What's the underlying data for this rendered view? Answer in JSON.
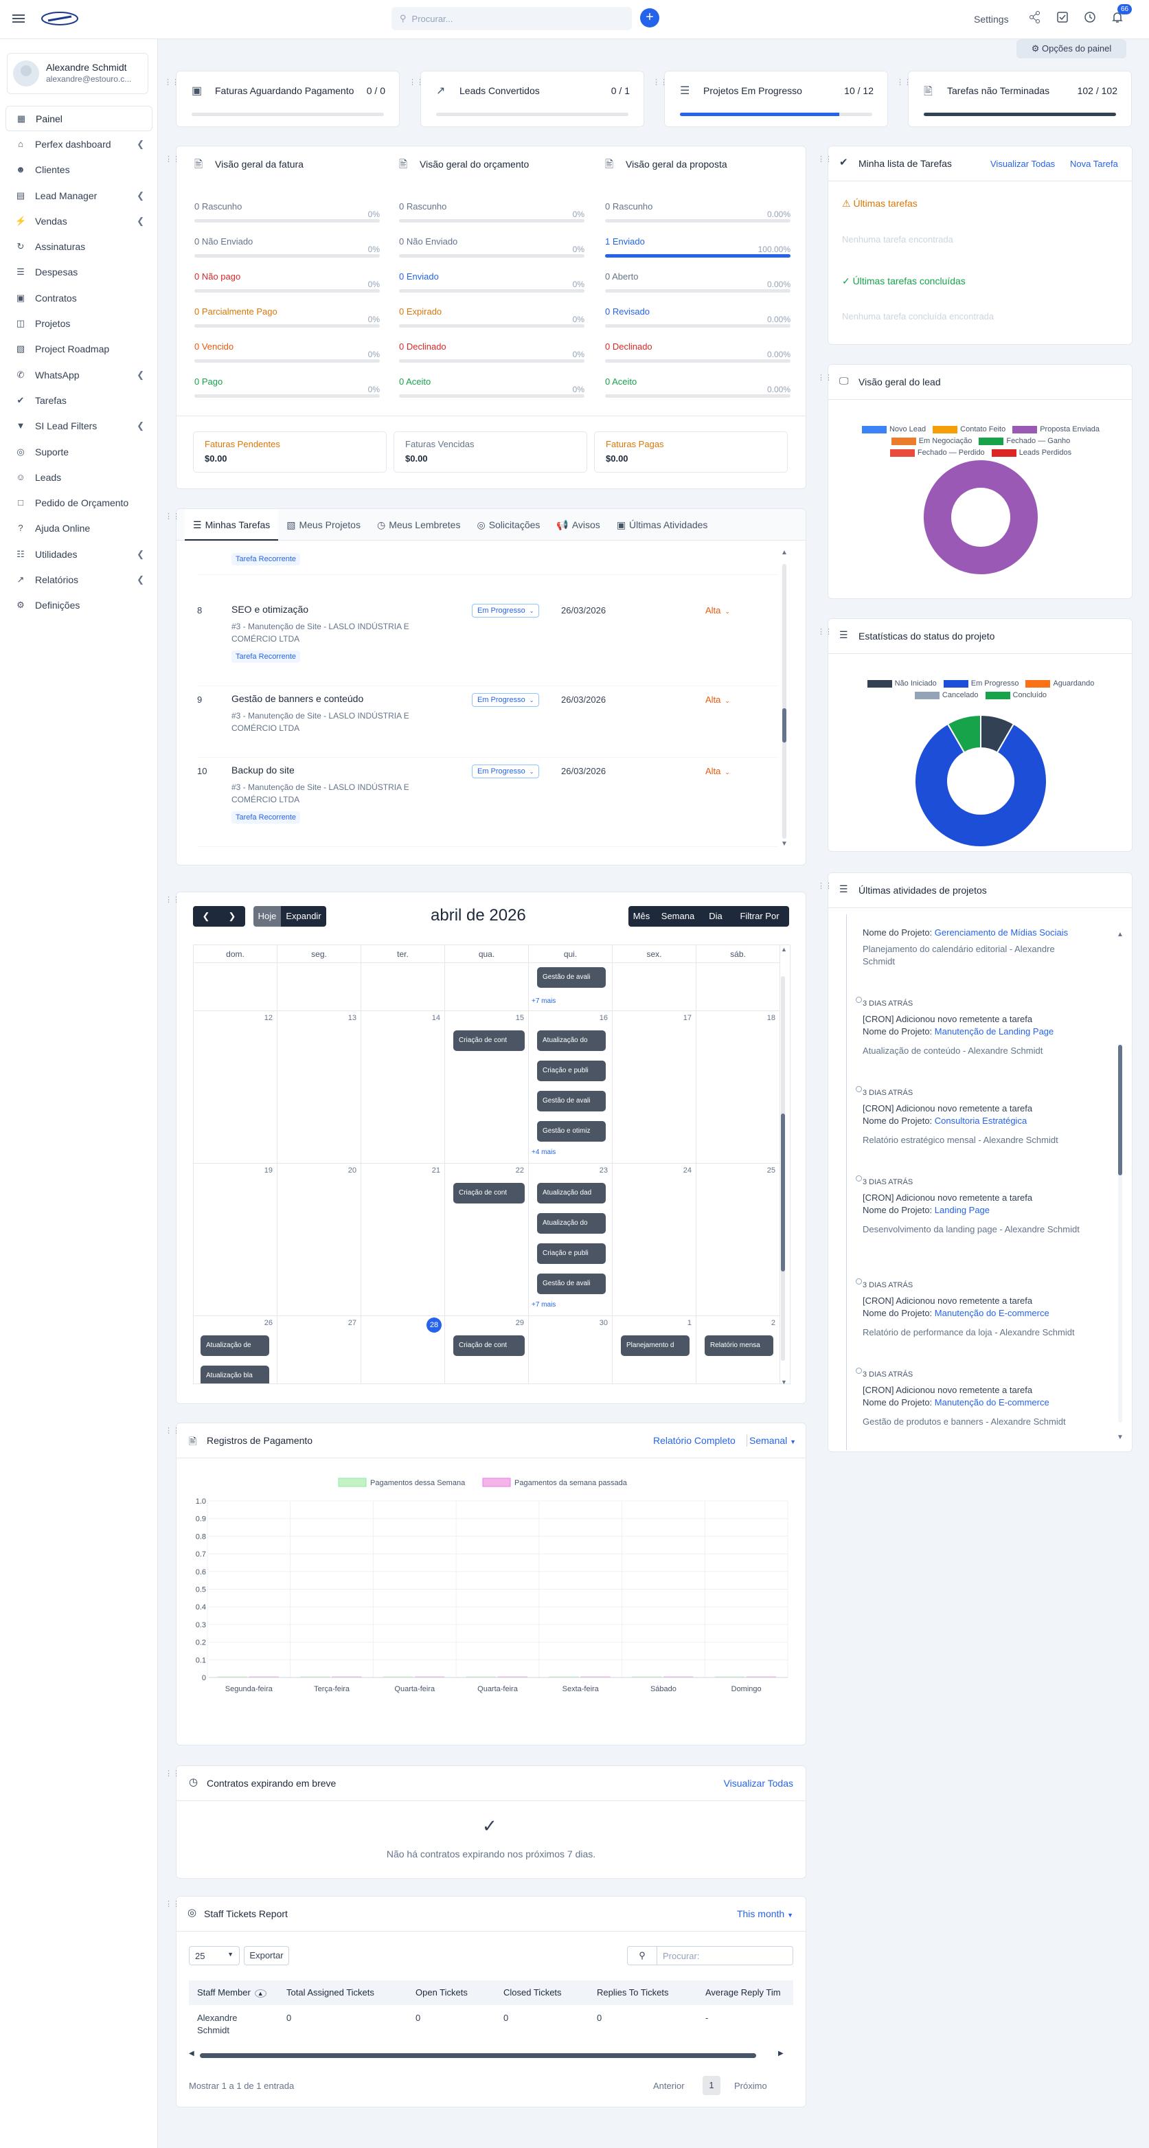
{
  "topbar": {
    "search_placeholder": "Procurar...",
    "settings": "Settings",
    "notif_count": "66"
  },
  "user": {
    "name": "Alexandre Schmidt",
    "email": "alexandre@estouro.c..."
  },
  "nav": [
    {
      "label": "Painel",
      "icon": "dashboard-icon",
      "active": true
    },
    {
      "label": "Perfex dashboard",
      "icon": "home-icon",
      "chevron": true
    },
    {
      "label": "Clientes",
      "icon": "user-icon"
    },
    {
      "label": "Lead Manager",
      "icon": "briefcase-icon",
      "chevron": true
    },
    {
      "label": "Vendas",
      "icon": "bolt-icon",
      "chevron": true
    },
    {
      "label": "Assinaturas",
      "icon": "refresh-icon"
    },
    {
      "label": "Despesas",
      "icon": "receipt-icon"
    },
    {
      "label": "Contratos",
      "icon": "document-icon"
    },
    {
      "label": "Projetos",
      "icon": "folder-icon"
    },
    {
      "label": "Project Roadmap",
      "icon": "chart-icon"
    },
    {
      "label": "WhatsApp",
      "icon": "whatsapp-icon",
      "chevron": true
    },
    {
      "label": "Tarefas",
      "icon": "check-circle-icon"
    },
    {
      "label": "SI Lead Filters",
      "icon": "filter-icon",
      "chevron": true
    },
    {
      "label": "Suporte",
      "icon": "lifebuoy-icon"
    },
    {
      "label": "Leads",
      "icon": "users-icon"
    },
    {
      "label": "Pedido de Orçamento",
      "icon": "file-icon"
    },
    {
      "label": "Ajuda Online",
      "icon": "help-icon"
    },
    {
      "label": "Utilidades",
      "icon": "grid-icon",
      "chevron": true
    },
    {
      "label": "Relatórios",
      "icon": "trend-icon",
      "chevron": true
    },
    {
      "label": "Definições",
      "icon": "gear-icon"
    }
  ],
  "panel_options": "Opções do painel",
  "stats": [
    {
      "label": "Faturas Aguardando Pagamento",
      "value": "0 / 0",
      "progress": 0,
      "color": "#2563eb"
    },
    {
      "label": "Leads Convertidos",
      "value": "0 / 1",
      "progress": 0,
      "color": "#2563eb"
    },
    {
      "label": "Projetos Em Progresso",
      "value": "10 / 12",
      "progress": 0.83,
      "color": "#2563eb"
    },
    {
      "label": "Tarefas não Terminadas",
      "value": "102 / 102",
      "progress": 1.0,
      "color": "#334155"
    }
  ],
  "overview": {
    "columns": [
      {
        "title": "Visão geral da fatura",
        "rows": [
          {
            "label": "0 Rascunho",
            "pct": "0%",
            "color": "#64748b",
            "fill": 0
          },
          {
            "label": "0 Não Enviado",
            "pct": "0%",
            "color": "#64748b",
            "fill": 0
          },
          {
            "label": "0 Não pago",
            "pct": "0%",
            "color": "#dc2626",
            "fill": 0
          },
          {
            "label": "0 Parcialmente Pago",
            "pct": "0%",
            "color": "#d97706",
            "fill": 0
          },
          {
            "label": "0 Vencido",
            "pct": "0%",
            "color": "#ea580c",
            "fill": 0
          },
          {
            "label": "0 Pago",
            "pct": "0%",
            "color": "#16a34a",
            "fill": 0
          }
        ]
      },
      {
        "title": "Visão geral do orçamento",
        "rows": [
          {
            "label": "0 Rascunho",
            "pct": "0%",
            "color": "#64748b",
            "fill": 0
          },
          {
            "label": "0 Não Enviado",
            "pct": "0%",
            "color": "#64748b",
            "fill": 0
          },
          {
            "label": "0 Enviado",
            "pct": "0%",
            "color": "#2563eb",
            "fill": 0
          },
          {
            "label": "0 Expirado",
            "pct": "0%",
            "color": "#d97706",
            "fill": 0
          },
          {
            "label": "0 Declinado",
            "pct": "0%",
            "color": "#dc2626",
            "fill": 0
          },
          {
            "label": "0 Aceito",
            "pct": "0%",
            "color": "#16a34a",
            "fill": 0
          }
        ]
      },
      {
        "title": "Visão geral da proposta",
        "rows": [
          {
            "label": "0 Rascunho",
            "pct": "0.00%",
            "color": "#64748b",
            "fill": 0
          },
          {
            "label": "1 Enviado",
            "pct": "100.00%",
            "color": "#2563eb",
            "fill": 1
          },
          {
            "label": "0 Aberto",
            "pct": "0.00%",
            "color": "#64748b",
            "fill": 0
          },
          {
            "label": "0 Revisado",
            "pct": "0.00%",
            "color": "#2563eb",
            "fill": 0
          },
          {
            "label": "0 Declinado",
            "pct": "0.00%",
            "color": "#dc2626",
            "fill": 0
          },
          {
            "label": "0 Aceito",
            "pct": "0.00%",
            "color": "#16a34a",
            "fill": 0
          }
        ]
      }
    ],
    "summary": [
      {
        "label": "Faturas Pendentes",
        "value": "$0.00",
        "color": "#d97706"
      },
      {
        "label": "Faturas Vencidas",
        "value": "$0.00",
        "color": "#64748b"
      },
      {
        "label": "Faturas Pagas",
        "value": "$0.00",
        "color": "#d97706"
      }
    ]
  },
  "tasks_tabs": [
    "Minhas Tarefas",
    "Meus Projetos",
    "Meus Lembretes",
    "Solicitações",
    "Avisos",
    "Últimas Atividades"
  ],
  "tasks": [
    {
      "num": "8",
      "name": "SEO e otimização",
      "project": "#3 - Manutenção de Site - LASLO INDÚSTRIA E COMÉRCIO LTDA",
      "recurring": "Tarefa Recorrente",
      "status": "Em Progresso",
      "date": "26/03/2026",
      "priority": "Alta"
    },
    {
      "num": "9",
      "name": "Gestão de banners e conteúdo",
      "project": "#3 - Manutenção de Site - LASLO INDÚSTRIA E COMÉRCIO LTDA",
      "status": "Em Progresso",
      "date": "26/03/2026",
      "priority": "Alta"
    },
    {
      "num": "10",
      "name": "Backup do site",
      "project": "#3 - Manutenção de Site - LASLO INDÚSTRIA E COMÉRCIO LTDA",
      "recurring": "Tarefa Recorrente",
      "status": "Em Progresso",
      "date": "26/03/2026",
      "priority": "Alta"
    }
  ],
  "task_top_badge": "Tarefa Recorrente",
  "calendar": {
    "title": "abril de 2026",
    "today": "Hoje",
    "expand": "Expandir",
    "views": [
      "Mês",
      "Semana",
      "Dia",
      "Filtrar Por"
    ],
    "weekdays": [
      "dom.",
      "seg.",
      "ter.",
      "qua.",
      "qui.",
      "sex.",
      "sáb."
    ],
    "weeks": [
      {
        "days": [
          "",
          "",
          "",
          "",
          "",
          "",
          ""
        ],
        "events": [
          {
            "col": 4,
            "slot": 0,
            "text": "Gestão de avali"
          }
        ],
        "more": [
          {
            "col": 4,
            "text": "+7 mais"
          }
        ]
      },
      {
        "days": [
          "12",
          "13",
          "14",
          "15",
          "16",
          "17",
          "18"
        ],
        "events": [
          {
            "col": 3,
            "slot": 0,
            "text": "Criação de cont"
          },
          {
            "col": 4,
            "slot": 0,
            "text": "Atualização do"
          },
          {
            "col": 4,
            "slot": 1,
            "text": "Criação e publi"
          },
          {
            "col": 4,
            "slot": 2,
            "text": "Gestão de avali"
          },
          {
            "col": 4,
            "slot": 3,
            "text": "Gestão e otimiz"
          }
        ],
        "more": [
          {
            "col": 4,
            "text": "+4 mais"
          }
        ]
      },
      {
        "days": [
          "19",
          "20",
          "21",
          "22",
          "23",
          "24",
          "25"
        ],
        "events": [
          {
            "col": 3,
            "slot": 0,
            "text": "Criação de cont"
          },
          {
            "col": 4,
            "slot": 0,
            "text": "Atualização dad"
          },
          {
            "col": 4,
            "slot": 1,
            "text": "Atualização do"
          },
          {
            "col": 4,
            "slot": 2,
            "text": "Criação e publi"
          },
          {
            "col": 4,
            "slot": 3,
            "text": "Gestão de avali"
          }
        ],
        "more": [
          {
            "col": 4,
            "text": "+7 mais"
          }
        ]
      },
      {
        "days": [
          "26",
          "27",
          "28",
          "29",
          "30",
          "1",
          "2"
        ],
        "events": [
          {
            "col": 0,
            "slot": 0,
            "text": "Atualização de"
          },
          {
            "col": 0,
            "slot": 1,
            "text": "Atualização bla"
          },
          {
            "col": 3,
            "slot": 0,
            "text": "Criação de cont"
          },
          {
            "col": 5,
            "slot": 0,
            "text": "Planejamento d"
          },
          {
            "col": 6,
            "slot": 0,
            "text": "Relatório mensa"
          }
        ],
        "more": []
      }
    ]
  },
  "payments": {
    "title": "Registros de Pagamento",
    "report": "Relatório Completo",
    "period": "Semanal",
    "chart_data": {
      "type": "bar",
      "categories": [
        "Segunda-feira",
        "Terça-feira",
        "Quarta-feira",
        "Quarta-feira",
        "Sexta-feira",
        "Sábado",
        "Domingo"
      ],
      "series": [
        {
          "name": "Pagamentos dessa Semana",
          "values": [
            0,
            0,
            0,
            0,
            0,
            0,
            0
          ],
          "color": "#c6f1c4"
        },
        {
          "name": "Pagamentos da semana passada",
          "values": [
            0,
            0,
            0,
            0,
            0,
            0,
            0
          ],
          "color": "#f5b4e6"
        }
      ],
      "ylim": [
        0,
        1.0
      ],
      "yticks": [
        "0",
        "0.1",
        "0.2",
        "0.3",
        "0.4",
        "0.5",
        "0.6",
        "0.7",
        "0.8",
        "0.9",
        "1.0"
      ]
    }
  },
  "contracts": {
    "title": "Contratos expirando em breve",
    "view_all": "Visualizar Todas",
    "empty": "Não há contratos expirando nos próximos 7 dias."
  },
  "tickets": {
    "title": "Staff Tickets Report",
    "period": "This month",
    "page_size": "25",
    "export": "Exportar",
    "search_placeholder": "Procurar:",
    "columns": [
      "Staff Member",
      "Total Assigned Tickets",
      "Open Tickets",
      "Closed Tickets",
      "Replies To Tickets",
      "Average Reply Tim"
    ],
    "rows": [
      [
        "Alexandre Schmidt",
        "0",
        "0",
        "0",
        "0",
        "-"
      ]
    ],
    "info": "Mostrar 1 a 1 de 1 entrada",
    "prev": "Anterior",
    "page": "1",
    "next": "Próximo"
  },
  "mytasks": {
    "title": "Minha lista de Tarefas",
    "view_all": "Visualizar Todas",
    "new_task": "Nova Tarefa",
    "latest": "Últimas tarefas",
    "latest_empty": "Nenhuma tarefa encontrada",
    "done": "Últimas tarefas concluídas",
    "done_empty": "Nenhuma tarefa concluída encontrada"
  },
  "leads": {
    "title": "Visão geral do lead",
    "chart_data": {
      "type": "pie",
      "labels": [
        "Novo Lead",
        "Contato Feito",
        "Proposta Enviada",
        "Em Negociação",
        "Fechado — Ganho",
        "Fechado — Perdido",
        "Leads Perdidos"
      ],
      "values": [
        0,
        0,
        1,
        0,
        0,
        0,
        0
      ],
      "colors": [
        "#3b82f6",
        "#f59e0b",
        "#9b59b6",
        "#ea7c2c",
        "#16a34a",
        "#e74c3c",
        "#dc2626"
      ]
    }
  },
  "projstatus": {
    "title": "Estatísticas do status do projeto",
    "chart_data": {
      "type": "pie",
      "labels": [
        "Não Iniciado",
        "Em Progresso",
        "Aguardando",
        "Cancelado",
        "Concluído"
      ],
      "values": [
        1,
        10,
        0,
        0,
        1
      ],
      "colors": [
        "#334155",
        "#1d4ed8",
        "#f97316",
        "#94a3b8",
        "#16a34a"
      ]
    }
  },
  "activities": {
    "title": "Últimas atividades de projetos",
    "first": {
      "prefix": "Nome do Projeto: ",
      "project": "Gerenciamento de Mídias Sociais",
      "sub": "Planejamento do calendário editorial - Alexandre Schmidt"
    },
    "items": [
      {
        "ago": "3 DIAS ATRÁS",
        "msg": "[CRON] Adicionou novo remetente a tarefa",
        "prefix": "Nome do Projeto: ",
        "project": "Manutenção de Landing Page",
        "sub": "Atualização de conteúdo - Alexandre Schmidt"
      },
      {
        "ago": "3 DIAS ATRÁS",
        "msg": "[CRON] Adicionou novo remetente a tarefa",
        "prefix": "Nome do Projeto: ",
        "project": "Consultoria Estratégica",
        "sub": "Relatório estratégico mensal - Alexandre Schmidt"
      },
      {
        "ago": "3 DIAS ATRÁS",
        "msg": "[CRON] Adicionou novo remetente a tarefa",
        "prefix": "Nome do Projeto: ",
        "project": "Landing Page",
        "sub": "Desenvolvimento da landing page - Alexandre Schmidt"
      },
      {
        "ago": "3 DIAS ATRÁS",
        "msg": "[CRON] Adicionou novo remetente a tarefa",
        "prefix": "Nome do Projeto: ",
        "project": "Manutenção do E-commerce",
        "sub": "Relatório de performance da loja - Alexandre Schmidt"
      },
      {
        "ago": "3 DIAS ATRÁS",
        "msg": "[CRON] Adicionou novo remetente a tarefa",
        "prefix": "Nome do Projeto: ",
        "project": "Manutenção do E-commerce",
        "sub": "Gestão de produtos e banners - Alexandre Schmidt"
      }
    ]
  }
}
